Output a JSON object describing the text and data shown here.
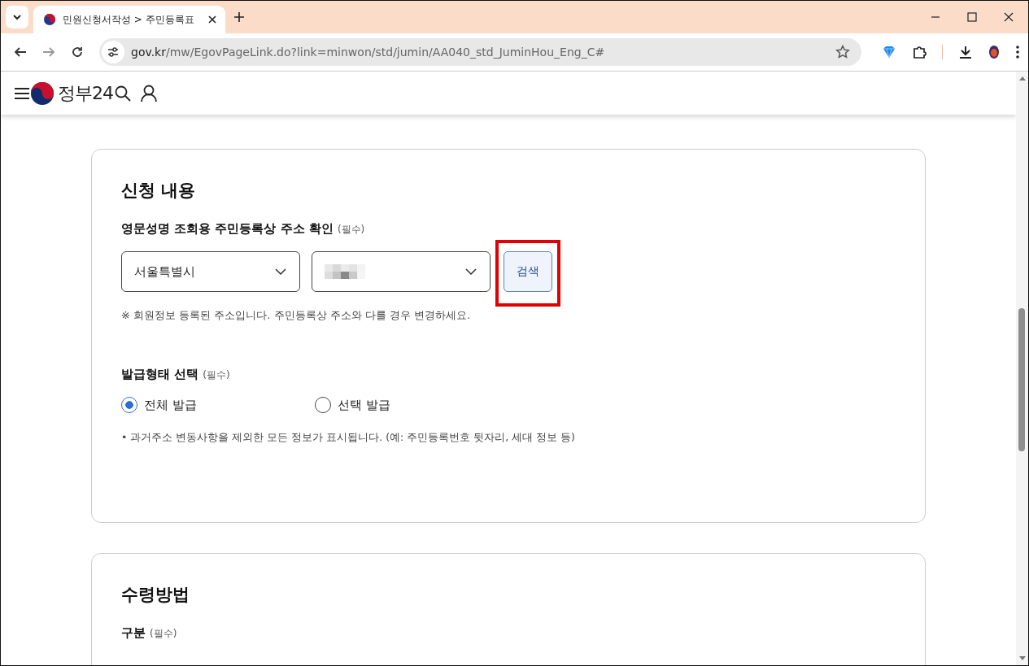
{
  "browser": {
    "tab_title": "민원신청서작성 > 주민등록표",
    "url_host": "gov.kr",
    "url_path": "/mw/EgovPageLink.do?link=minwon/std/jumin/AA040_std_JuminHou_Eng_C#"
  },
  "site": {
    "logo_text": "정부24"
  },
  "sections": [
    {
      "title": "신청 내용",
      "fields": [
        {
          "kind": "address",
          "label": "영문성명 조회용 주민등록상 주소 확인",
          "required": "(필수)",
          "city": "서울특별시",
          "search_button": {
            "label": "검색",
            "highlighted": true
          },
          "note": "※ 회원정보 등록된 주소입니다. 주민등록상 주소와 다를 경우 변경하세요."
        },
        {
          "kind": "radio",
          "label": "발급형태 선택",
          "required": "(필수)",
          "options": [
            {
              "label": "전체 발급",
              "selected": true
            },
            {
              "label": "선택 발급",
              "selected": false
            }
          ],
          "note": "• 과거주소 변동사항을 제외한 모든 정보가 표시됩니다. (예: 주민등록번호 뒷자리, 세대 정보 등)"
        }
      ]
    },
    {
      "title": "수령방법",
      "fields": [
        {
          "kind": "heading",
          "label": "구분",
          "required": "(필수)"
        }
      ]
    }
  ]
}
